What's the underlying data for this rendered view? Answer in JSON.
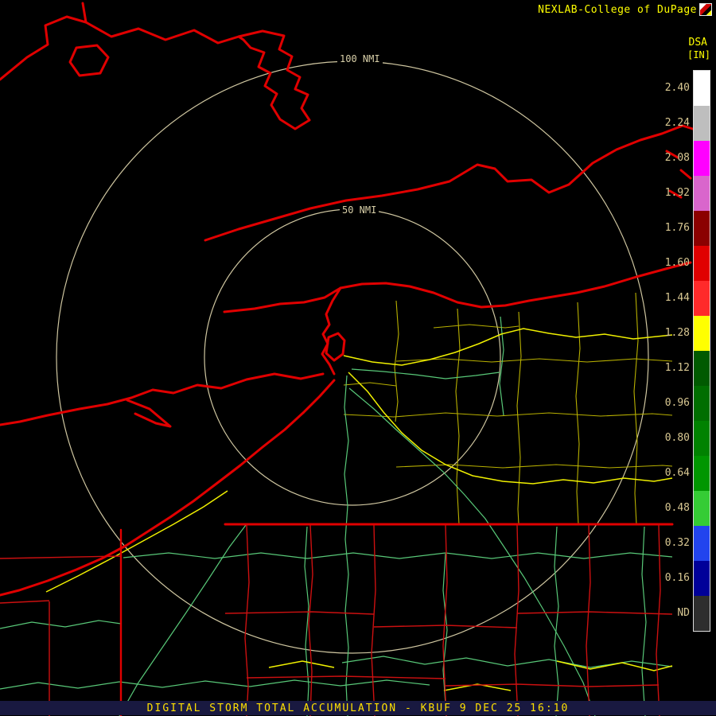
{
  "header": {
    "brand": "NEXLAB-College of DuPage"
  },
  "legend": {
    "product": "DSA",
    "units": "[IN]",
    "label_color": "#d9c892",
    "stops": [
      {
        "label": "2.40",
        "color": "#ffffff"
      },
      {
        "label": "2.24",
        "color": "#bebebe"
      },
      {
        "label": "2.08",
        "color": "#ff00ff"
      },
      {
        "label": "1.92",
        "color": "#d966cc"
      },
      {
        "label": "1.76",
        "color": "#8b0000"
      },
      {
        "label": "1.60",
        "color": "#e00000"
      },
      {
        "label": "1.44",
        "color": "#ff2a2a"
      },
      {
        "label": "1.28",
        "color": "#ffff00"
      },
      {
        "label": "1.12",
        "color": "#005a00"
      },
      {
        "label": "0.96",
        "color": "#006e00"
      },
      {
        "label": "0.80",
        "color": "#008200"
      },
      {
        "label": "0.64",
        "color": "#009600"
      },
      {
        "label": "0.48",
        "color": "#35cc35"
      },
      {
        "label": "0.32",
        "color": "#2244ee"
      },
      {
        "label": "0.16",
        "color": "#000099"
      },
      {
        "label": "ND",
        "color": "#2e2e2e"
      }
    ]
  },
  "map": {
    "range_rings": [
      {
        "label": "100 NMI"
      },
      {
        "label": "50 NMI"
      }
    ],
    "colors": {
      "ring": "#cfc6a0",
      "border": "#e00000",
      "border_thin": "#cc1010",
      "county_yellow": "#b8b000",
      "road_yellow": "#f0f000",
      "road_green": "#58c878"
    }
  },
  "statusbar": {
    "title": "DIGITAL STORM TOTAL ACCUMULATION - KBUF 9 DEC 25 16:10"
  }
}
